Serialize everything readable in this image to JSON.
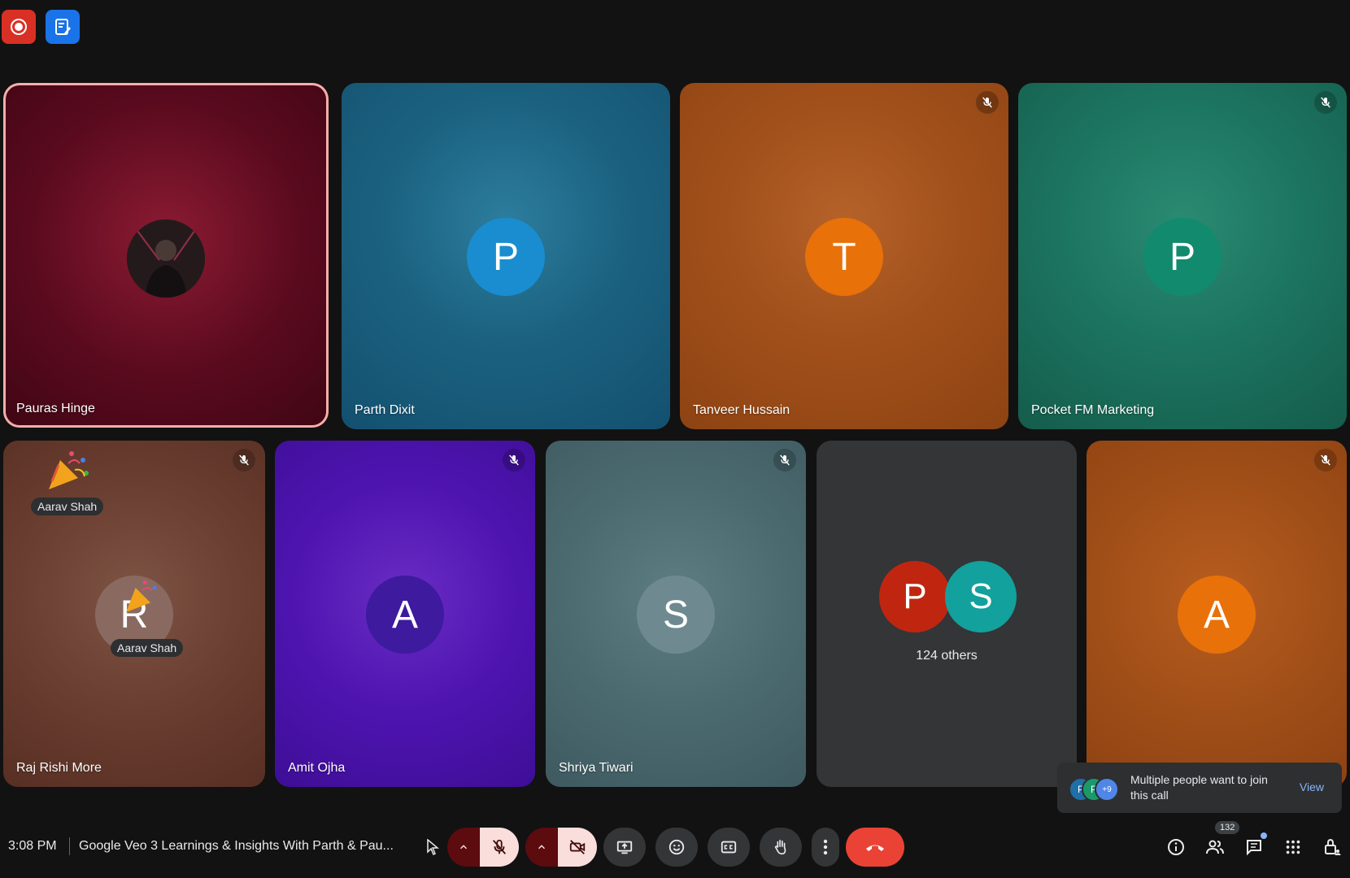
{
  "tiles": {
    "row1": [
      {
        "name": "Pauras Hinge"
      },
      {
        "name": "Parth Dixit",
        "initial": "P"
      },
      {
        "name": "Tanveer Hussain",
        "initial": "T"
      },
      {
        "name": "Pocket FM Marketing",
        "initial": "P"
      }
    ],
    "row2": [
      {
        "name": "Raj Rishi More",
        "initial": "R",
        "reaction_name": "Aarav Shah"
      },
      {
        "name": "Amit Ojha",
        "initial": "A"
      },
      {
        "name": "Shriya Tiwari",
        "initial": "S"
      },
      {
        "others_label": "124 others",
        "initials": [
          "P",
          "S"
        ]
      },
      {
        "initial": "A"
      }
    ]
  },
  "bottom_bar": {
    "time": "3:08 PM",
    "meeting_title": "Google Veo 3 Learnings & Insights With Parth & Pau...",
    "people_count": "132"
  },
  "toast": {
    "message": "Multiple people want to join this call",
    "action": "View",
    "avatar_initials": [
      "P",
      "P"
    ],
    "more_count": "+9"
  },
  "colors": {
    "end_call": "#ea4335",
    "active_tile_border": "#f6aea9",
    "link": "#8ab4f8"
  }
}
